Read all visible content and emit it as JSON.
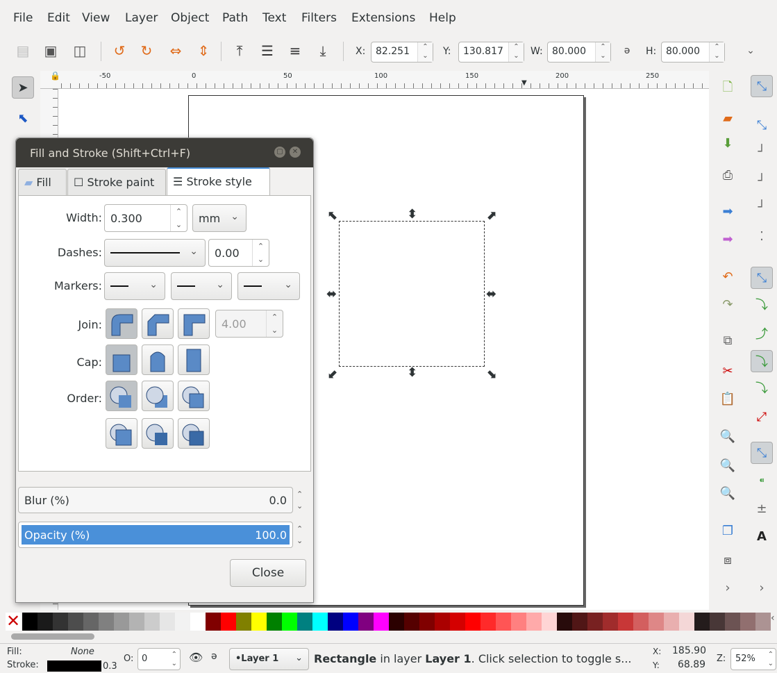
{
  "menu": [
    "File",
    "Edit",
    "View",
    "Layer",
    "Object",
    "Path",
    "Text",
    "Filters",
    "Extensions",
    "Help"
  ],
  "toolbar": {
    "x_label": "X:",
    "x_value": "82.251",
    "y_label": "Y:",
    "y_value": "130.817",
    "w_label": "W:",
    "w_value": "80.000",
    "h_label": "H:",
    "h_value": "80.000"
  },
  "ruler": {
    "ticks": [
      "-50",
      "0",
      "50",
      "100",
      "150",
      "200",
      "250"
    ]
  },
  "dialog": {
    "title": "Fill and Stroke (Shift+Ctrl+F)",
    "tabs": [
      "Fill",
      "Stroke paint",
      "Stroke style"
    ],
    "width_label": "Width:",
    "width_value": "0.300",
    "width_unit": "mm",
    "dashes_label": "Dashes:",
    "dashes_offset": "0.00",
    "markers_label": "Markers:",
    "join_label": "Join:",
    "miter_value": "4.00",
    "cap_label": "Cap:",
    "order_label": "Order:",
    "blur_label": "Blur (%)",
    "blur_value": "0.0",
    "opacity_label": "Opacity (%)",
    "opacity_value": "100.0",
    "close_label": "Close"
  },
  "status": {
    "fill_label": "Fill:",
    "fill_value": "None",
    "stroke_label": "Stroke:",
    "stroke_width": "0.3",
    "opacity_label": "O:",
    "opacity_value": "0",
    "layer": "•Layer 1",
    "msg_bold1": "Rectangle",
    "msg_mid": " in layer ",
    "msg_bold2": "Layer 1",
    "msg_tail": ". Click selection to toggle s...",
    "cx_label": "X:",
    "cx_value": "185.90",
    "cy_label": "Y:",
    "cy_value": "68.89",
    "zoom_label": "Z:",
    "zoom_value": "52%"
  },
  "palette": [
    "#000000",
    "#1a1a1a",
    "#333333",
    "#4d4d4d",
    "#666666",
    "#808080",
    "#999999",
    "#b3b3b3",
    "#cccccc",
    "#e6e6e6",
    "#f2f2f2",
    "#ffffff",
    "#800000",
    "#ff0000",
    "#808000",
    "#ffff00",
    "#008000",
    "#00ff00",
    "#008080",
    "#00ffff",
    "#000080",
    "#0000ff",
    "#800080",
    "#ff00ff",
    "#2b0000",
    "#550000",
    "#800000",
    "#aa0000",
    "#d40000",
    "#ff0000",
    "#ff2a2a",
    "#ff5555",
    "#ff8080",
    "#ffaaaa",
    "#ffd5d5",
    "#280b0b",
    "#501616",
    "#782121",
    "#a02c2c",
    "#c83737",
    "#d35f5f",
    "#de8787",
    "#e9afaf",
    "#f4d7d7",
    "#241c1c",
    "#483737",
    "#6c5353",
    "#916f6f",
    "#ac9393"
  ]
}
